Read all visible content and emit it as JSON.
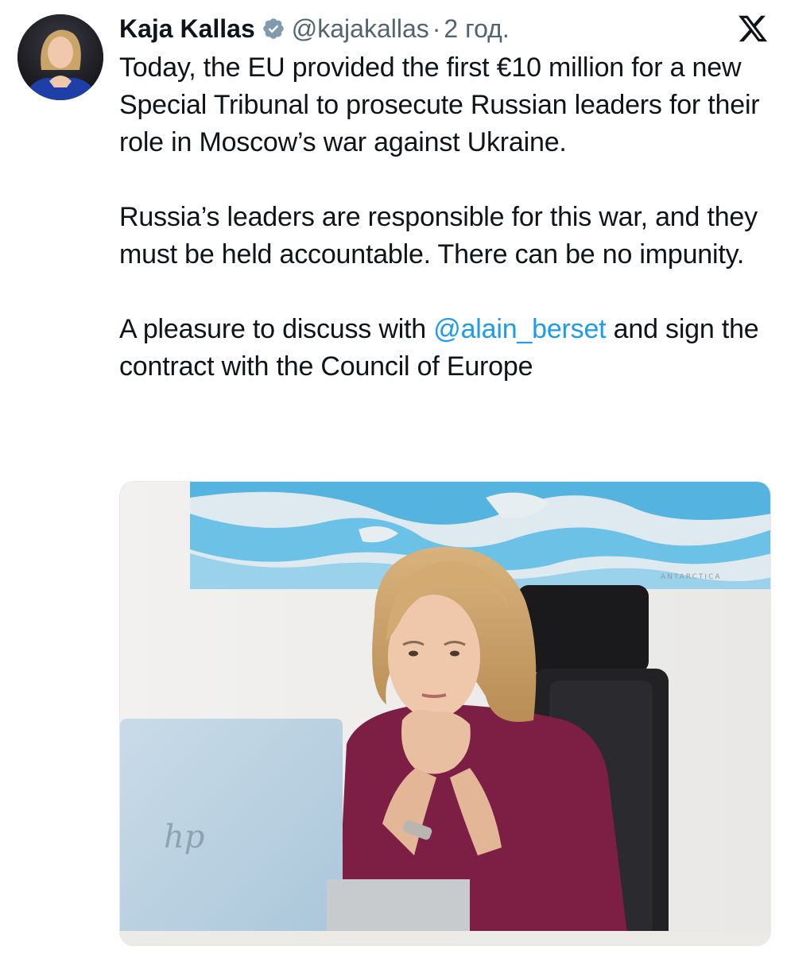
{
  "author": {
    "name": "Kaja Kallas",
    "handle": "@kajakallas",
    "separator": "·",
    "time": "2 год.",
    "verified": true,
    "avatar_icon": "profile-photo"
  },
  "tweet": {
    "para1": "Today, the EU provided the first €10 million for a new Special Tribunal to prosecute Russian leaders for their role in Moscow’s war against Ukraine.",
    "para2": "Russia’s leaders are responsible for this war, and they must be held accountable. There can be no impunity.",
    "para3_before": "A pleasure to discuss with ",
    "mention": "@alain_berset",
    "para3_after": " and sign the contract with the Council of Europe"
  },
  "media": {
    "icon": "photo",
    "map_label": "ANTARCTICA"
  },
  "colors": {
    "text": "#0f1419",
    "secondary": "#536471",
    "link": "#1d9bf0",
    "verified_badge": "#829aab"
  },
  "icons": {
    "brand": "x-logo-icon",
    "verified": "verified-badge-icon"
  }
}
